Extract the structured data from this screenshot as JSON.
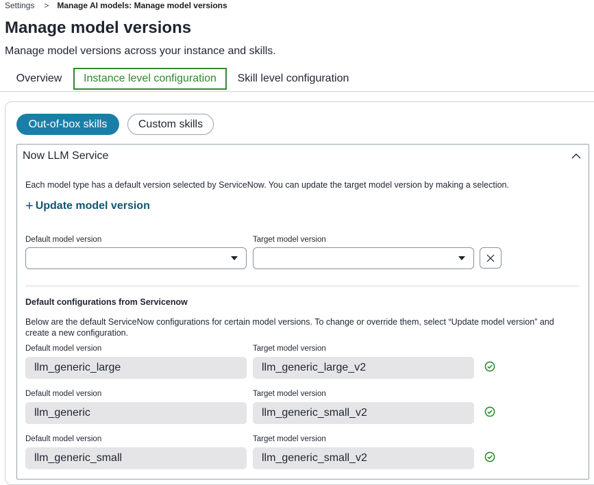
{
  "breadcrumb": {
    "root": "Settings",
    "separator": ">",
    "current": "Manage AI models: Manage model versions"
  },
  "page": {
    "title": "Manage model versions",
    "description": "Manage model versions across your instance and skills."
  },
  "tabs": [
    {
      "label": "Overview",
      "selected": false
    },
    {
      "label": "Instance level configuration",
      "selected": true
    },
    {
      "label": "Skill level configuration",
      "selected": false
    }
  ],
  "skill_toggle": {
    "active": "Out-of-box skills",
    "inactive": "Custom skills"
  },
  "panel": {
    "title": "Now LLM Service",
    "info": "Each model type has a default version selected by ServiceNow. You can update the target model version by making a selection.",
    "update_link": "Update model version",
    "default_label": "Default model version",
    "target_label": "Target model version",
    "default_value": "",
    "target_value": ""
  },
  "defaults_section": {
    "heading": "Default configurations from Servicenow",
    "description": "Below are the default ServiceNow configurations for certain model versions. To change or override them, select “Update model version” and create a new configuration.",
    "rows": [
      {
        "default_label": "Default model version",
        "target_label": "Target model version",
        "default_value": "llm_generic_large",
        "target_value": "llm_generic_large_v2"
      },
      {
        "default_label": "Default model version",
        "target_label": "Target model version",
        "default_value": "llm_generic",
        "target_value": "llm_generic_small_v2"
      },
      {
        "default_label": "Default model version",
        "target_label": "Target model version",
        "default_value": "llm_generic_small",
        "target_value": "llm_generic_small_v2"
      }
    ]
  },
  "colors": {
    "accent": "#1a7fa6",
    "selected_tab": "#2e8a2e",
    "success": "#2e8a2e",
    "link": "#12556f"
  },
  "icons": {
    "plus": "plus-icon",
    "chevron": "chevron-up-icon",
    "caret": "caret-down-icon",
    "close": "close-icon",
    "check": "check-circle-icon"
  }
}
